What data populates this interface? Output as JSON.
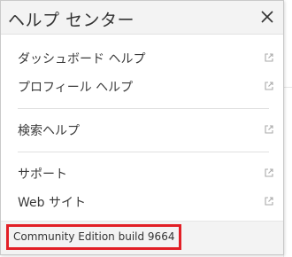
{
  "panel": {
    "title": "ヘルプ センター",
    "close_icon": "close-icon"
  },
  "groups": [
    {
      "items": [
        {
          "label": "ダッシュボード ヘルプ",
          "icon": "external-link-icon"
        },
        {
          "label": "プロフィール ヘルプ",
          "icon": "external-link-icon"
        }
      ]
    },
    {
      "items": [
        {
          "label": "検索ヘルプ",
          "icon": "external-link-icon"
        }
      ]
    },
    {
      "items": [
        {
          "label": "サポート",
          "icon": "external-link-icon"
        },
        {
          "label": "Web サイト",
          "icon": "external-link-icon"
        }
      ]
    }
  ],
  "footer": {
    "version": "Community Edition build 9664"
  },
  "colors": {
    "highlight_border": "#e21f26",
    "header_bg": "#f3f3f3"
  }
}
